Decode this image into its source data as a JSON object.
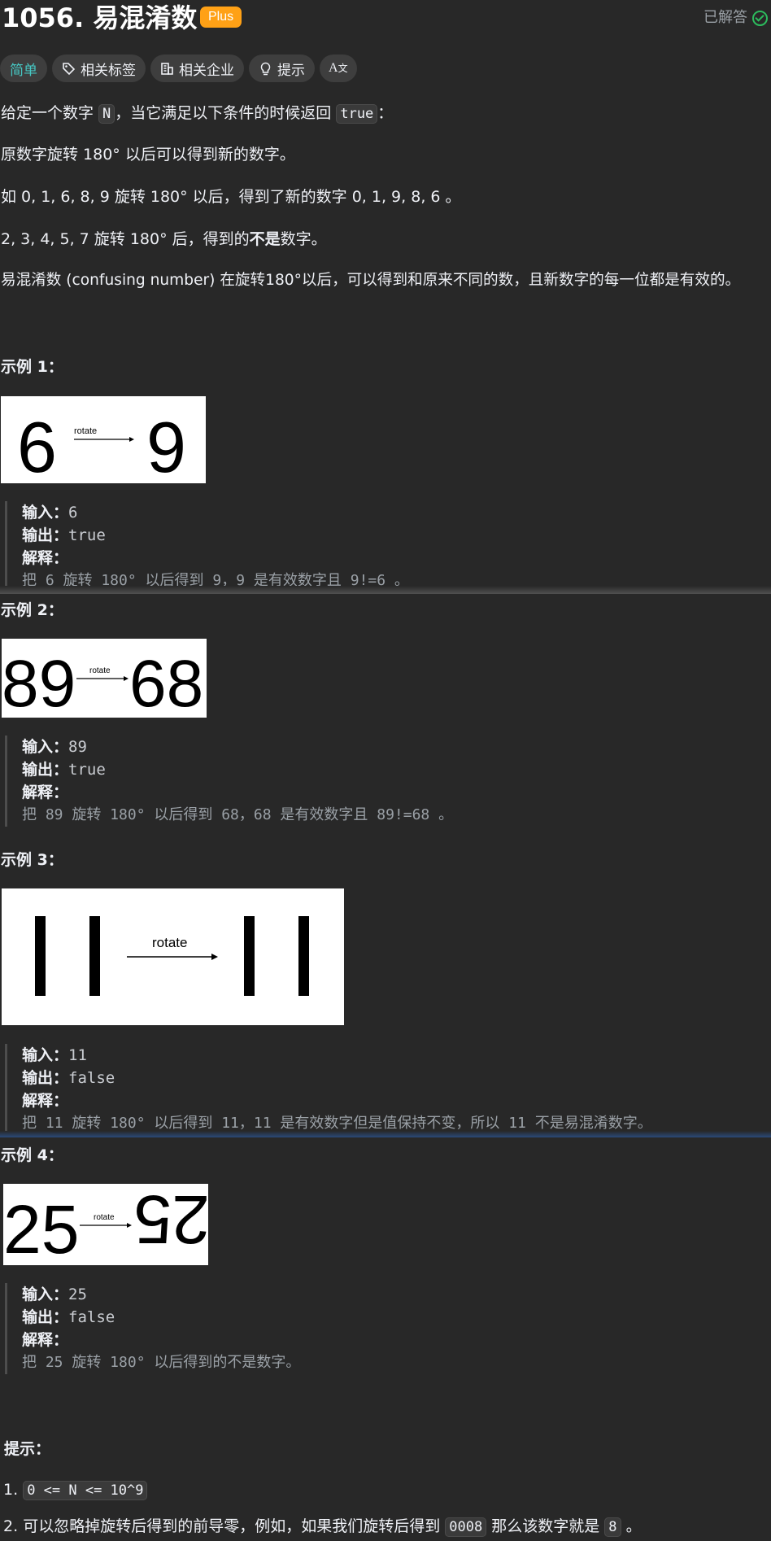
{
  "header": {
    "title": "1056. 易混淆数",
    "plus_badge": "Plus",
    "solved_label": "已解答"
  },
  "tags": {
    "difficulty": "简单",
    "related_tags": "相关标签",
    "related_companies": "相关企业",
    "hint": "提示",
    "translate_icon": "translate-icon"
  },
  "description": {
    "line1_pre": "给定一个数字 ",
    "line1_code1": "N",
    "line1_mid": "，当它满足以下条件的时候返回 ",
    "line1_code2": "true",
    "line1_post": "：",
    "line2": "原数字旋转 180° 以后可以得到新的数字。",
    "line3": "如 0, 1, 6, 8, 9 旋转 180° 以后，得到了新的数字 0, 1, 9, 8, 6 。",
    "line4_pre": "2, 3, 4, 5, 7 旋转 180° 后，得到的",
    "line4_bold": "不是",
    "line4_post": "数字。",
    "line5": "易混淆数 (confusing number) 在旋转180°以后，可以得到和原来不同的数，且新数字的每一位都是有效的。"
  },
  "labels": {
    "input": "输入：",
    "output": "输出：",
    "explanation": "解释："
  },
  "examples": [
    {
      "heading": "示例 1：",
      "img_left": "6",
      "img_right": "9",
      "rotate": "rotate",
      "input": "6",
      "output": "true",
      "explanation": "把 6 旋转 180° 以后得到 9，9 是有效数字且 9!=6 。"
    },
    {
      "heading": "示例 2：",
      "img_left": "89",
      "img_right": "68",
      "rotate": "rotate",
      "input": "89",
      "output": "true",
      "explanation": "把 89 旋转 180° 以后得到 68，68 是有效数字且 89!=68 。"
    },
    {
      "heading": "示例 3：",
      "img_left": "11",
      "img_right": "11",
      "rotate": "rotate",
      "input": "11",
      "output": "false",
      "explanation": "把 11 旋转 180° 以后得到 11，11 是有效数字但是值保持不变，所以 11 不是易混淆数字。"
    },
    {
      "heading": "示例 4：",
      "img_left": "25",
      "img_right": "25",
      "rotate": "rotate",
      "input": "25",
      "output": "false",
      "explanation": "把 25 旋转 180° 以后得到的不是数字。"
    }
  ],
  "hints": {
    "heading": "提示：",
    "item1_num": "1.",
    "item1_code": "0 <= N <= 10^9",
    "item2_num": "2.",
    "item2_pre": "可以忽略掉旋转后得到的前导零，例如，如果我们旋转后得到 ",
    "item2_code1": "0008",
    "item2_mid": " 那么该数字就是 ",
    "item2_code2": "8",
    "item2_post": " 。"
  },
  "colors": {
    "background": "#282828",
    "easy": "#46c6c2",
    "plus": "#ffa116",
    "solved_check": "#2cbb5d"
  }
}
